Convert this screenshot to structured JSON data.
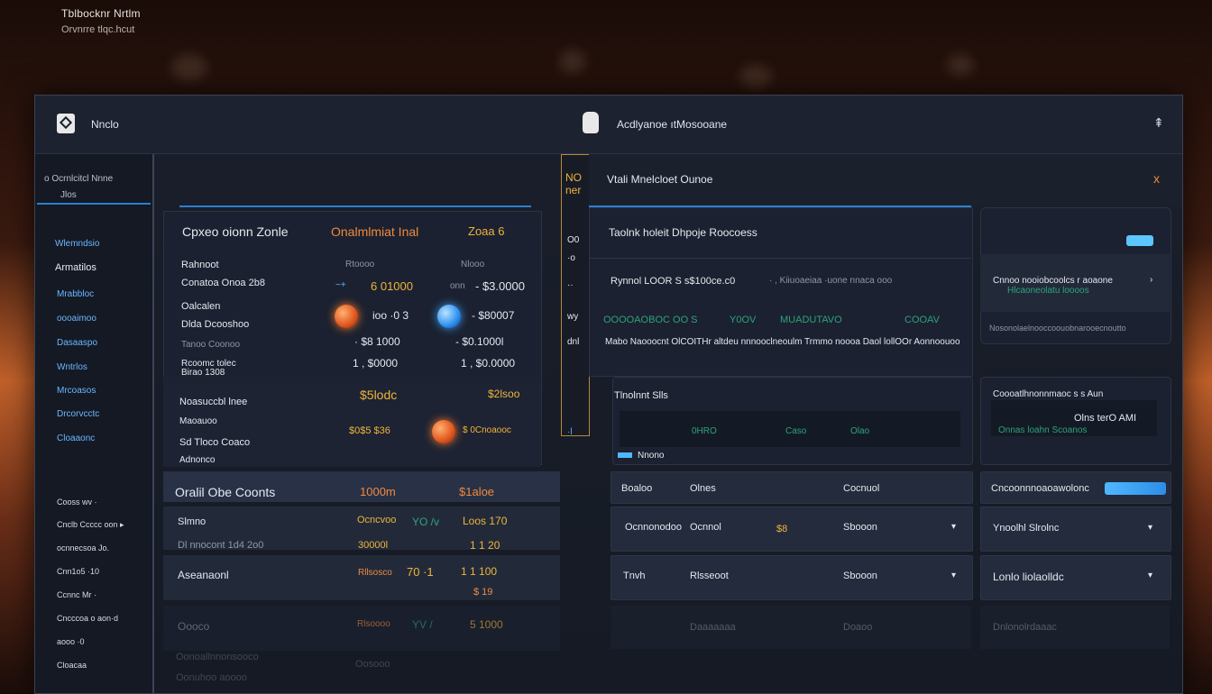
{
  "top": {
    "title": "Tblbocknr Nrtlm",
    "subtitle": "Orvnrre tlqc.hcut"
  },
  "window": {
    "app_name": "Nnclo",
    "center_title": "Acdlyanoe ıtMosooane",
    "sidebar": {
      "head1": "o Ocrnlcitcl Nnne",
      "head2": "Jlos",
      "items": [
        "Wlemndsio",
        "Armatilos",
        "Mrabbloc",
        "oooaimoo",
        "Dasaaspo",
        "Wntrlos",
        "Mrcoasos",
        "Drcorvcctc",
        "Cloaaonc"
      ],
      "lower_items": [
        "Cooss wv  ·",
        "Cnclb Ccccc oon ▸",
        "ocnnecsoa Jo.",
        "Cnn1o5 ·10",
        "Ccnnc Mr ·",
        "Cncccoa o aon·d",
        "aooo ·0",
        "Cloacaa"
      ]
    },
    "left_panel": {
      "title": "Cpxeo oionn Zonle",
      "title2": "Onalmlmiat Inal",
      "title3": "Zoaa 6",
      "col_a": "Rahnoot",
      "col_b": "Rtoooo",
      "col_c": "Nlooo",
      "rows": [
        {
          "label": "Conatoa Onoa 2b8",
          "v1": "6 01000",
          "v1_pre": "~+",
          "v2": "- $3.0000",
          "v2_pre": "onn"
        },
        {
          "label": "Oalcalen",
          "v1": "ioo ·0 3",
          "v2": "-  $80007",
          "v2_pre": ""
        },
        {
          "label": "Dlda Dcooshoo",
          "v1": "",
          "v2": "",
          "v2_pre": ""
        },
        {
          "label": "Tanoo Coonoo",
          "v1": "·  $8 1000",
          "v2": "-  $0.1000l",
          "v2_pre": ""
        },
        {
          "label": "Rcoomc tolec",
          "v1": "1  , $0000",
          "v2": "1  , $0.0000",
          "v2_pre": ""
        },
        {
          "label": "Birao 1308",
          "v1": "",
          "v2": "",
          "v2_pre": ""
        }
      ],
      "section2": {
        "labels": [
          "Noasuccbl lnee",
          "Maoauoo",
          "Sd  Tloco Coaco",
          "Adnonco"
        ],
        "v_top": "$5lodc",
        "v_top2": "$2lsoo",
        "v_mid": "$0$5 $36",
        "v_mid2": "$ 0Cnoaooc"
      }
    },
    "totals": {
      "label": "Oralil Obe Coonts",
      "v1": "1000m",
      "v2": "$1aloe",
      "rows": [
        {
          "label": "Slmno",
          "label2": "Dl nnocont 1d4 2o0",
          "a": "Ocncvoo",
          "b": "YO /v",
          "c": "Loos  170",
          "a2": "30000l",
          "c2": "1 1 20"
        },
        {
          "label": "Aseanaonl",
          "a": "Rllsosco",
          "b": "70  ·1",
          "c": "1 1 100",
          "c2": "$ 19"
        },
        {
          "label": "Oooco",
          "a": "Rlsoooo",
          "b": "YV  /",
          "c": "5 1000",
          "c2": ""
        }
      ],
      "faded": [
        "Oonoallnnonsooco",
        "Oosooo",
        "Oonuhoo aoooo"
      ]
    },
    "strip": {
      "top": "NO ner",
      "values": [
        "O0",
        "·o",
        "··",
        "wy",
        "dnl",
        "·l"
      ]
    },
    "right": {
      "header": "Vtali Mnelcloet Ounoe",
      "header_accent": "Vtali",
      "close": "x",
      "card1_title": "Taolnk holeit Dhpoje Roocoess",
      "card1_row1a": "Rynnol LOOR S s$100ce.c0",
      "card1_row1b": "· , Kiiuoaeiaa ·uone nnaca ooo",
      "card1_row2": [
        "OOOOAOBOC OO S",
        "Y0OV",
        "MUADUTAVO",
        "COOAV"
      ],
      "card1_row3": "Mabo Naooocnt OlCOITHr altdeu nnnooclneoulm Trmmo noooa Daol lollOOr Aonnoouoo",
      "side1_title": "Cnnoo nooiobcoolcs r aoaone",
      "side1_sub": "Hlcaoneolatu loooos",
      "side1_foot": "Nosonolaelnooccoouobnarooecnoutto",
      "card2_title": "Tlnolnnt Slls",
      "card2_cols": [
        "0HRO",
        "Caso",
        "Olao"
      ],
      "card2_foot": "Nnono",
      "side2_title": "Coooatlhnonnmaoc s s Aun",
      "side2_value": "Olns terO AMI",
      "side2_sub": "Onnas loahn Scoanos",
      "table": {
        "head": [
          "Boaloo",
          "Olnes",
          "Cocnuol"
        ],
        "rows": [
          {
            "a": "Ocnnonodoo",
            "b": "Ocnnol",
            "c": "$8",
            "d": "Sbooon"
          },
          {
            "a": "Tnvh",
            "b": "Rlsseoot",
            "c": "",
            "d": "Sbooon"
          },
          {
            "a": "",
            "b": "Daaaaaaa",
            "c": "",
            "d": "Doaoo"
          }
        ]
      },
      "side_list": [
        "Cncoonnnoaoawolonc",
        "Ynoolhl Slrolnc",
        "Lonlo liolaolldc",
        "Dnlonolrdaaac"
      ]
    }
  }
}
